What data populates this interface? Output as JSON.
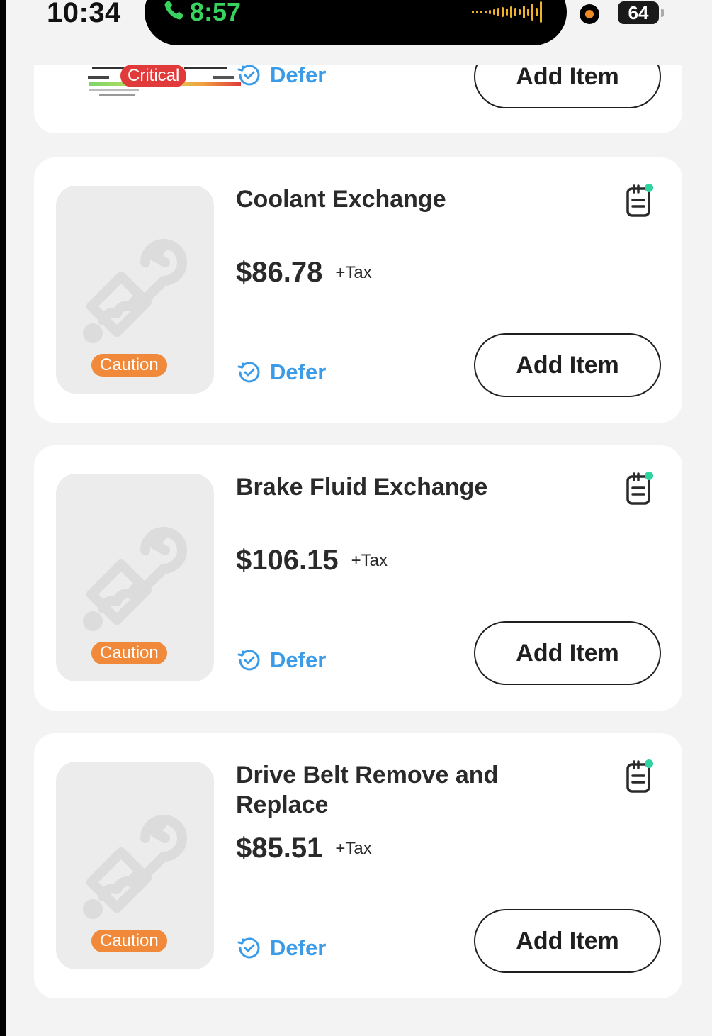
{
  "status_bar": {
    "time": "10:34",
    "call_timer": "8:57",
    "battery": "64"
  },
  "colors": {
    "defer_blue": "#3a9be8",
    "caution_orange": "#f08a3a",
    "critical_red": "#e03a3a",
    "call_green": "#37d35e",
    "note_dot": "#2fd3a0"
  },
  "items": [
    {
      "badge": "Critical",
      "defer_label": "Defer",
      "add_label": "Add Item"
    },
    {
      "title": "Coolant Exchange",
      "price": "$86.78",
      "tax": "+Tax",
      "badge": "Caution",
      "defer_label": "Defer",
      "add_label": "Add Item"
    },
    {
      "title": "Brake Fluid Exchange",
      "price": "$106.15",
      "tax": "+Tax",
      "badge": "Caution",
      "defer_label": "Defer",
      "add_label": "Add Item"
    },
    {
      "title": "Drive Belt Remove and Replace",
      "price": "$85.51",
      "tax": "+Tax",
      "badge": "Caution",
      "defer_label": "Defer",
      "add_label": "Add Item"
    }
  ],
  "icons": {
    "thumbnail": "wrench-plug-icon",
    "note": "notes-icon",
    "defer": "defer-clock-icon",
    "call": "phone-icon"
  }
}
